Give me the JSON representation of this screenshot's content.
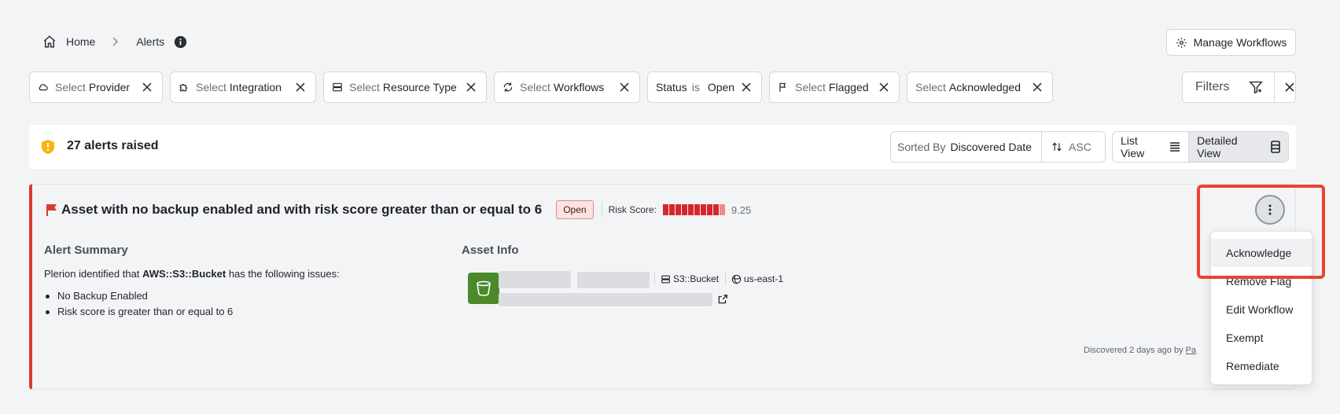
{
  "breadcrumb": {
    "home": "Home",
    "current": "Alerts"
  },
  "header": {
    "manage_workflows": "Manage Workflows"
  },
  "filters": {
    "provider": {
      "prefix": "Select",
      "value": "Provider"
    },
    "integration": {
      "prefix": "Select",
      "value": "Integration"
    },
    "resource_type": {
      "prefix": "Select",
      "value": "Resource Type"
    },
    "workflows": {
      "prefix": "Select",
      "value": "Workflows"
    },
    "status": {
      "field": "Status",
      "op": "is",
      "value": "Open"
    },
    "flagged": {
      "prefix": "Select",
      "value": "Flagged"
    },
    "acknowledged": {
      "prefix": "Select",
      "value": "Acknowledged"
    },
    "filters_label": "Filters"
  },
  "summary_bar": {
    "count_text": "27 alerts raised",
    "sorted_by_label": "Sorted By",
    "sorted_by_value": "Discovered Date",
    "sort_order": "ASC",
    "list_view": "List View",
    "detailed_view": "Detailed View",
    "active_view": "Detailed View"
  },
  "alert": {
    "title": "Asset with no backup enabled and with risk score greater than or equal to 6",
    "status": "Open",
    "risk_label": "Risk Score:",
    "risk_value": "9.25",
    "risk_fraction": 0.925,
    "summary_heading": "Alert Summary",
    "summary_intro_pre": "Plerion identified that ",
    "summary_intro_asset": "AWS::S3::Bucket",
    "summary_intro_post": " has the following issues:",
    "issues": [
      "No Backup Enabled",
      "Risk score is greater than or equal to 6"
    ],
    "asset_heading": "Asset Info",
    "asset_type": "S3::Bucket",
    "asset_region": "us-east-1",
    "discovered_text": "Discovered 2 days ago by",
    "discovered_by": "Pa"
  },
  "menu": {
    "items": [
      "Acknowledge",
      "Remove Flag",
      "Edit Workflow",
      "Exempt",
      "Remediate"
    ]
  },
  "colors": {
    "accent_red": "#d93b30",
    "highlight": "#e8442e",
    "aws_green": "#4a8a2a",
    "shield": "#f5b50a"
  },
  "icons": [
    "home-icon",
    "info-icon",
    "gear-icon",
    "cloud-icon",
    "puzzle-icon",
    "server-icon",
    "refresh-icon",
    "flag-icon",
    "close-icon",
    "filter-icon",
    "shield-icon",
    "sort-icon",
    "list-icon",
    "detail-icon",
    "kebab-icon",
    "bucket-icon",
    "globe-icon",
    "external-link-icon"
  ]
}
